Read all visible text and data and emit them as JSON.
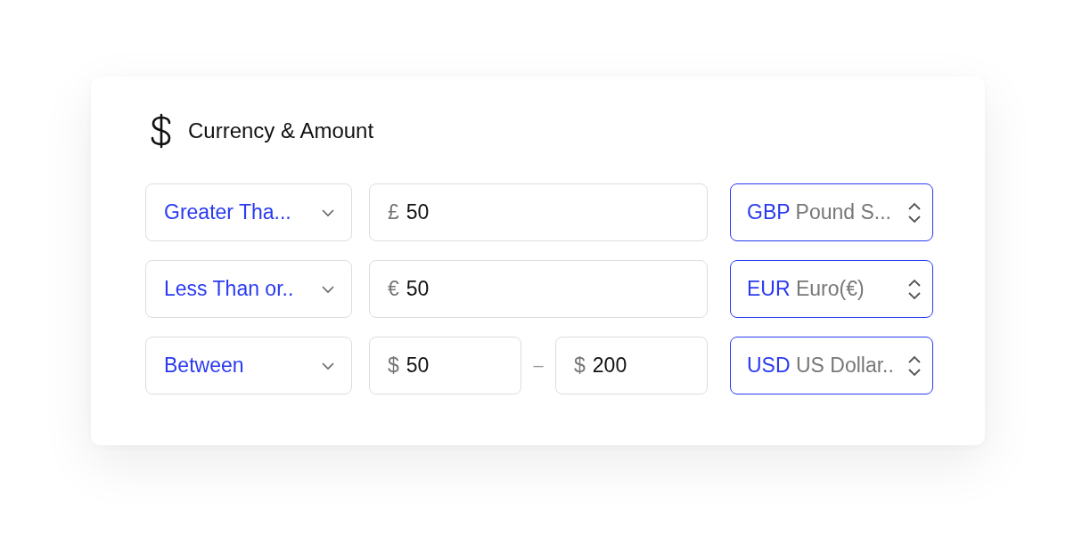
{
  "title": "Currency & Amount",
  "filters": [
    {
      "kind": "single",
      "operator": "Greater Tha...",
      "amounts": [
        {
          "symbol": "£",
          "value": "50"
        }
      ],
      "currency": {
        "code": "GBP",
        "name": "Pound S..."
      }
    },
    {
      "kind": "single",
      "operator": "Less Than or..",
      "amounts": [
        {
          "symbol": "€",
          "value": "50"
        }
      ],
      "currency": {
        "code": "EUR",
        "name": "Euro(€)"
      }
    },
    {
      "kind": "range",
      "operator": "Between",
      "amounts": [
        {
          "symbol": "$",
          "value": "50"
        },
        {
          "symbol": "$",
          "value": "200"
        }
      ],
      "separator": "–",
      "currency": {
        "code": "USD",
        "name": "US Dollar.."
      }
    }
  ]
}
